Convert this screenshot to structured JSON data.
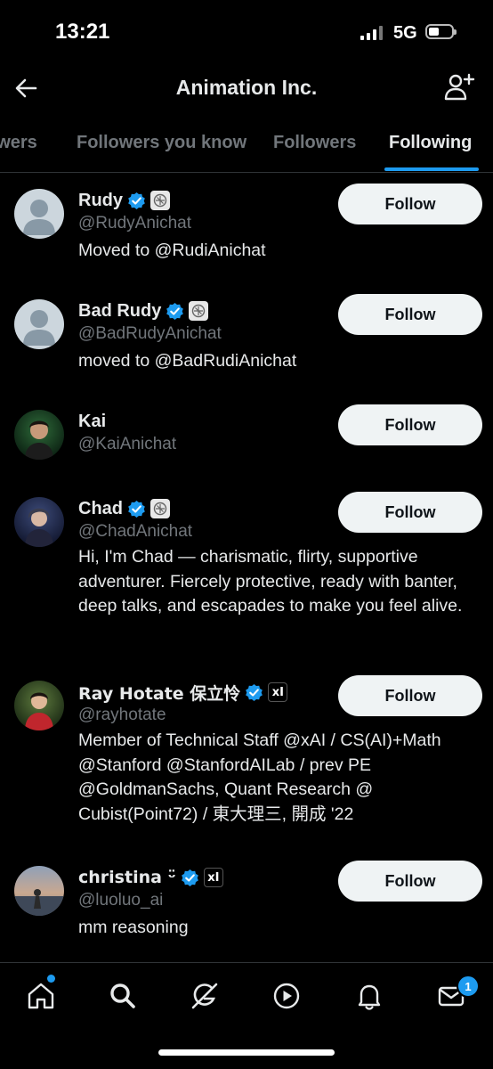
{
  "status": {
    "time": "13:21",
    "network": "5G"
  },
  "header": {
    "title": "Animation Inc."
  },
  "tabs": [
    "owers",
    "Followers you know",
    "Followers",
    "Following"
  ],
  "active_tab": "Following",
  "users": [
    {
      "name": "Rudy",
      "handle": "@RudyAnichat",
      "bio": "Moved to @RudiAnichat",
      "follow_label": "Follow"
    },
    {
      "name": "Bad Rudy",
      "handle": "@BadRudyAnichat",
      "bio": "moved to @BadRudiAnichat",
      "follow_label": "Follow"
    },
    {
      "name": "Kai",
      "handle": "@KaiAnichat",
      "bio": "",
      "follow_label": "Follow"
    },
    {
      "name": "Chad",
      "handle": "@ChadAnichat",
      "bio": "Hi, I'm Chad — charismatic, flirty, supportive adventurer. Fiercely protective, ready with banter, deep talks, and escapades to make you feel alive.",
      "follow_label": "Follow"
    },
    {
      "name": "Ray Hotate 保立怜",
      "handle": "@rayhotate",
      "bio": "Member of Technical Staff @xAI / CS(AI)+Math @Stanford @StanfordAILab / prev PE @GoldmanSachs, Quant Research @ Cubist(Point72) / 東大理三, 開成 '22",
      "follow_label": "Follow"
    },
    {
      "name": "christina ᵕ̈",
      "handle": "@luoluo_ai",
      "bio": "mm reasoning",
      "follow_label": "Follow"
    }
  ],
  "affiliate_logo": "xI",
  "nav": {
    "icons": [
      "home-icon",
      "search-icon",
      "grok-icon",
      "video-icon",
      "notifications-icon",
      "messages-icon"
    ],
    "messages_badge": "1"
  },
  "colors": {
    "accent": "#1d9bf0",
    "background": "#000000",
    "button": "#eff3f4",
    "muted": "#71767b"
  }
}
